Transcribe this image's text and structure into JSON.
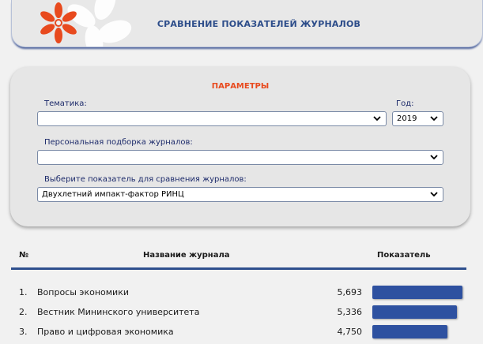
{
  "header": {
    "title": "СРАВНЕНИЕ ПОКАЗАТЕЛЕЙ ЖУРНАЛОВ"
  },
  "params": {
    "title": "ПАРАМЕТРЫ",
    "topic_label": "Тематика:",
    "topic_value": "",
    "year_label": "Год:",
    "year_value": "2019",
    "collection_label": "Персональная подборка журналов:",
    "collection_value": "",
    "indicator_label": "Выберите показатель для сравнения журналов:",
    "indicator_value": "Двухлетний импакт-фактор РИНЦ"
  },
  "table": {
    "col_num": "№",
    "col_name": "Название журнала",
    "col_value": "Показатель",
    "rows": [
      {
        "num": "1.",
        "name": "Вопросы экономики",
        "value": "5,693",
        "score": 5.693
      },
      {
        "num": "2.",
        "name": "Вестник Мининского университета",
        "value": "5,336",
        "score": 5.336
      },
      {
        "num": "3.",
        "name": "Право и цифровая экономика",
        "value": "4,750",
        "score": 4.75
      }
    ]
  },
  "colors": {
    "accent": "#2d4d8a",
    "params_title": "#e84a1e",
    "bar": "#2e51a0",
    "flower": "#e84a1e"
  },
  "icons": [
    "flower-logo-icon",
    "chevron-down-icon"
  ]
}
